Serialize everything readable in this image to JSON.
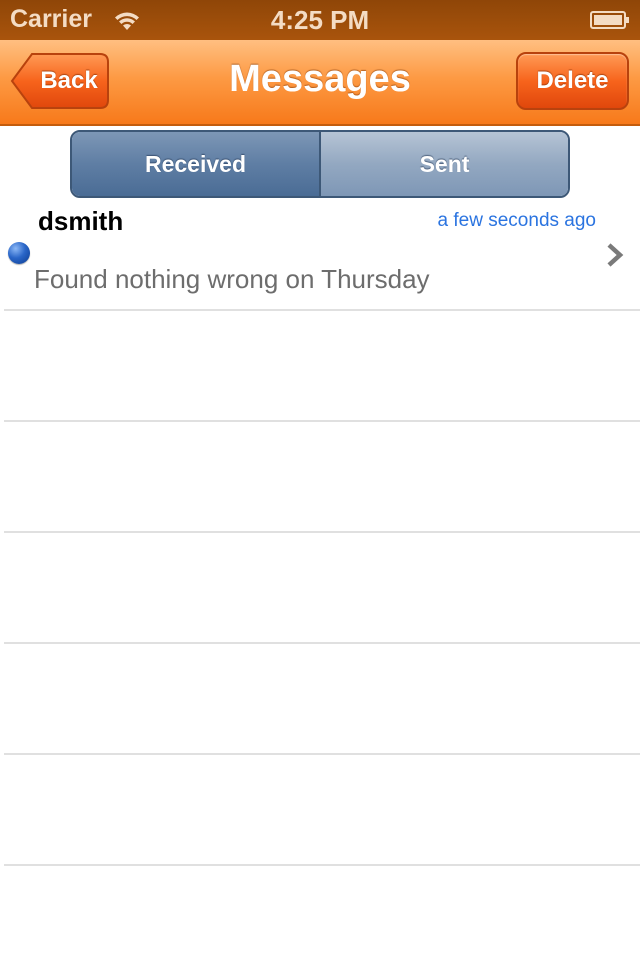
{
  "status_bar": {
    "carrier": "Carrier",
    "time": "4:25 PM"
  },
  "nav_bar": {
    "title": "Messages",
    "back_label": "Back",
    "delete_label": "Delete"
  },
  "segmented_control": {
    "segments": [
      {
        "label": "Received",
        "selected": true
      },
      {
        "label": "Sent",
        "selected": false
      }
    ]
  },
  "messages": [
    {
      "sender": "dsmith",
      "timestamp": "a few seconds ago",
      "preview": "Found nothing wrong on Thursday",
      "unread": true
    }
  ],
  "colors": {
    "nav_orange": "#fd9a44",
    "status_bar": "#a9540c",
    "segment_blue": "#5f7ea4",
    "timestamp_blue": "#2b74e0",
    "unread_dot": "#2a66c8"
  },
  "icons": [
    "wifi-icon",
    "battery-icon",
    "back-arrow-icon",
    "unread-dot-icon",
    "chevron-right-icon"
  ]
}
